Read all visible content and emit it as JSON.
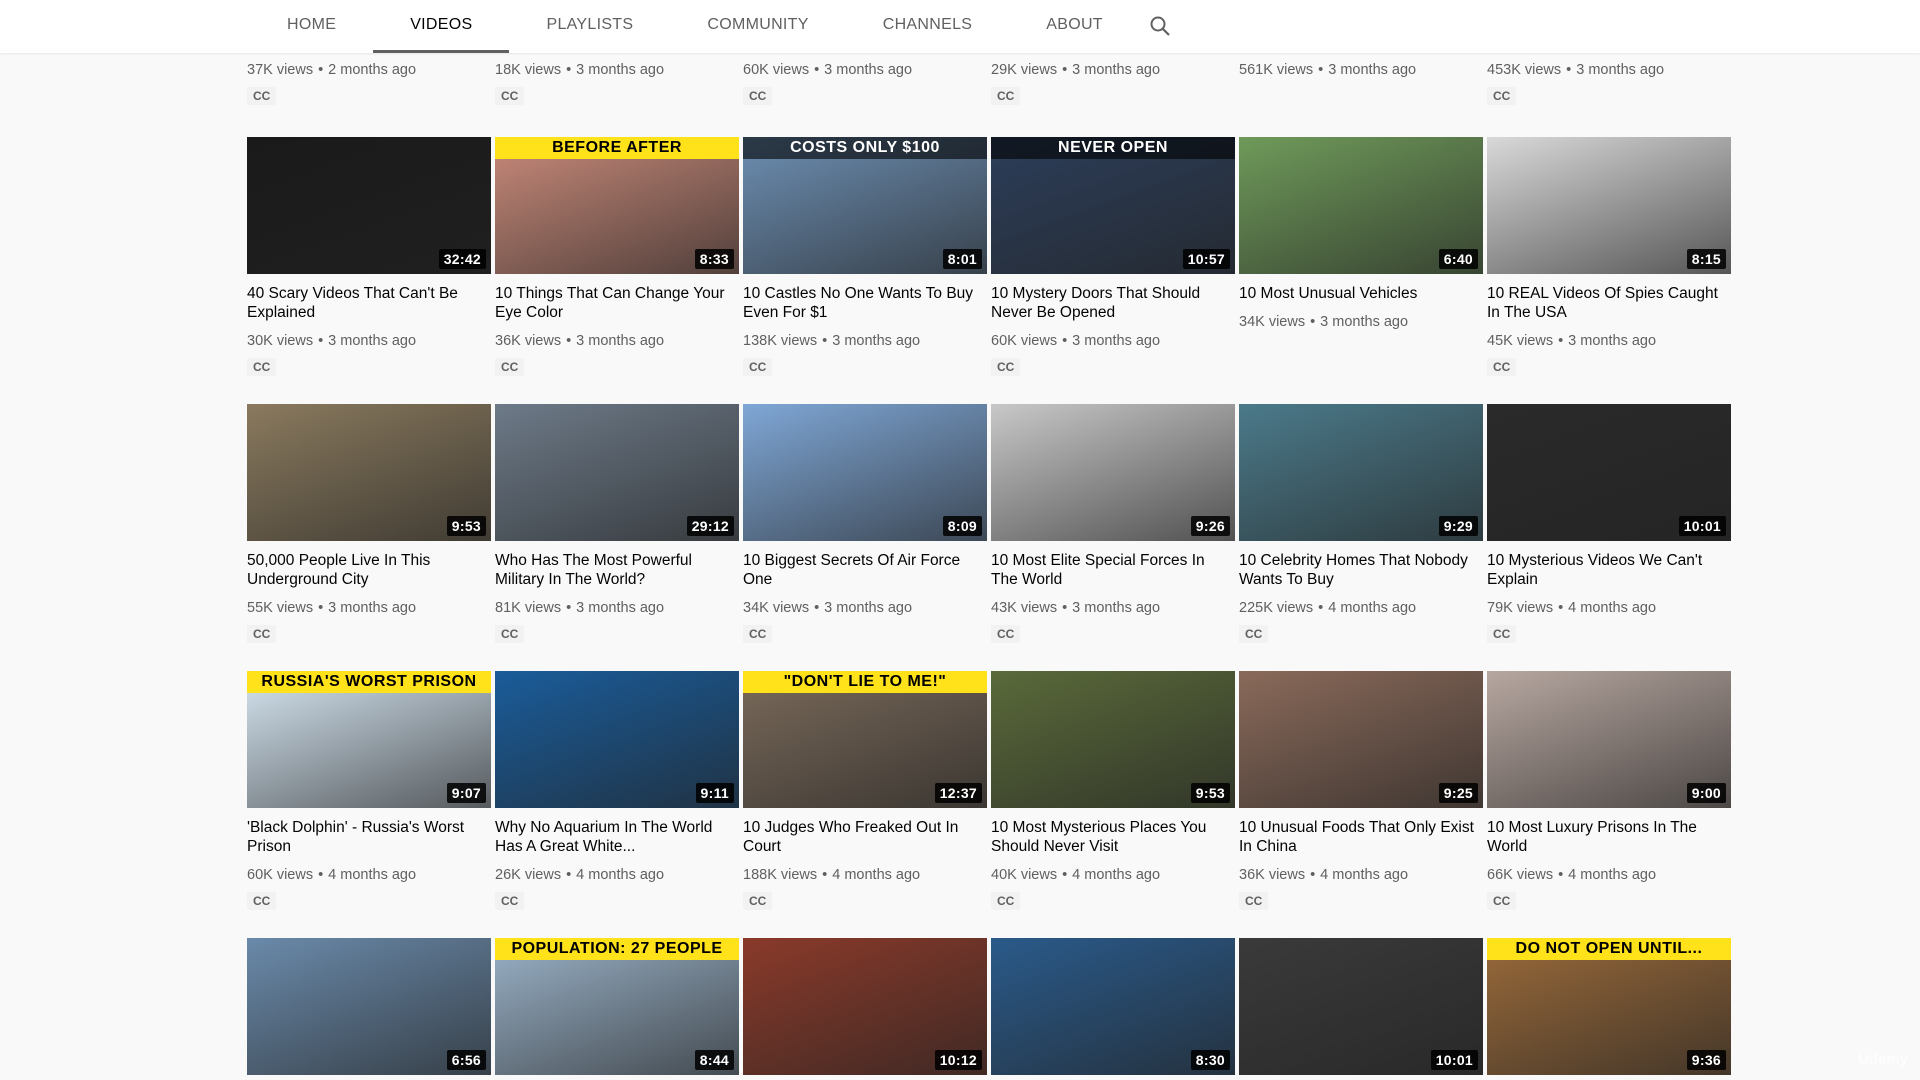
{
  "tabs": [
    {
      "label": "HOME",
      "active": false
    },
    {
      "label": "VIDEOS",
      "active": true
    },
    {
      "label": "PLAYLISTS",
      "active": false
    },
    {
      "label": "COMMUNITY",
      "active": false
    },
    {
      "label": "CHANNELS",
      "active": false
    },
    {
      "label": "ABOUT",
      "active": false
    }
  ],
  "search_icon": "search-icon",
  "top_row": [
    {
      "views": "37K views",
      "age": "2 months ago",
      "cc": "CC"
    },
    {
      "views": "18K views",
      "age": "3 months ago",
      "cc": "CC"
    },
    {
      "views": "60K views",
      "age": "3 months ago",
      "cc": "CC"
    },
    {
      "views": "29K views",
      "age": "3 months ago",
      "cc": "CC"
    },
    {
      "views": "561K views",
      "age": "3 months ago",
      "cc": ""
    },
    {
      "views": "453K views",
      "age": "3 months ago",
      "cc": "CC"
    }
  ],
  "rows": [
    [
      {
        "title": "40 Scary Videos That Can't Be Explained",
        "duration": "32:42",
        "views": "30K views",
        "age": "3 months ago",
        "cc": "CC",
        "caption": ""
      },
      {
        "title": "10 Things That Can Change Your Eye Color",
        "duration": "8:33",
        "views": "36K views",
        "age": "3 months ago",
        "cc": "CC",
        "caption": "BEFORE        AFTER"
      },
      {
        "title": "10 Castles No One Wants To Buy Even For $1",
        "duration": "8:01",
        "views": "138K views",
        "age": "3 months ago",
        "cc": "CC",
        "caption": "COSTS ONLY $100"
      },
      {
        "title": "10 Mystery Doors That Should Never Be Opened",
        "duration": "10:57",
        "views": "60K views",
        "age": "3 months ago",
        "cc": "CC",
        "caption": "NEVER OPEN"
      },
      {
        "title": "10 Most Unusual Vehicles",
        "duration": "6:40",
        "views": "34K views",
        "age": "3 months ago",
        "cc": "",
        "caption": ""
      },
      {
        "title": "10 REAL Videos Of Spies Caught In The USA",
        "duration": "8:15",
        "views": "45K views",
        "age": "3 months ago",
        "cc": "CC",
        "caption": ""
      }
    ],
    [
      {
        "title": "50,000 People Live In This Underground City",
        "duration": "9:53",
        "views": "55K views",
        "age": "3 months ago",
        "cc": "CC",
        "caption": ""
      },
      {
        "title": "Who Has The Most Powerful Military In The World?",
        "duration": "29:12",
        "views": "81K views",
        "age": "3 months ago",
        "cc": "CC",
        "caption": ""
      },
      {
        "title": "10 Biggest Secrets Of Air Force One",
        "duration": "8:09",
        "views": "34K views",
        "age": "3 months ago",
        "cc": "CC",
        "caption": ""
      },
      {
        "title": "10 Most Elite Special Forces In The World",
        "duration": "9:26",
        "views": "43K views",
        "age": "3 months ago",
        "cc": "CC",
        "caption": ""
      },
      {
        "title": "10 Celebrity Homes That Nobody Wants To Buy",
        "duration": "9:29",
        "views": "225K views",
        "age": "4 months ago",
        "cc": "CC",
        "caption": ""
      },
      {
        "title": "10 Mysterious Videos We Can't Explain",
        "duration": "10:01",
        "views": "79K views",
        "age": "4 months ago",
        "cc": "CC",
        "caption": ""
      }
    ],
    [
      {
        "title": "'Black Dolphin' - Russia's Worst Prison",
        "duration": "9:07",
        "views": "60K views",
        "age": "4 months ago",
        "cc": "CC",
        "caption": "RUSSIA'S WORST PRISON"
      },
      {
        "title": "Why No Aquarium In The World Has A Great White...",
        "duration": "9:11",
        "views": "26K views",
        "age": "4 months ago",
        "cc": "CC",
        "caption": ""
      },
      {
        "title": "10 Judges Who Freaked Out In Court",
        "duration": "12:37",
        "views": "188K views",
        "age": "4 months ago",
        "cc": "CC",
        "caption": "\"DON'T LIE TO ME!\""
      },
      {
        "title": "10 Most Mysterious Places You Should Never Visit",
        "duration": "9:53",
        "views": "40K views",
        "age": "4 months ago",
        "cc": "CC",
        "caption": ""
      },
      {
        "title": "10 Unusual Foods That Only Exist In China",
        "duration": "9:25",
        "views": "36K views",
        "age": "4 months ago",
        "cc": "CC",
        "caption": ""
      },
      {
        "title": "10 Most Luxury Prisons In The World",
        "duration": "9:00",
        "views": "66K views",
        "age": "4 months ago",
        "cc": "CC",
        "caption": ""
      }
    ],
    [
      {
        "duration": "6:56",
        "caption": ""
      },
      {
        "duration": "8:44",
        "caption": "POPULATION: 27 PEOPLE"
      },
      {
        "duration": "10:12",
        "caption": ""
      },
      {
        "duration": "8:30",
        "caption": ""
      },
      {
        "duration": "10:01",
        "caption": ""
      },
      {
        "duration": "9:36",
        "caption": "DO NOT OPEN UNTIL..."
      }
    ]
  ],
  "thumb_colors": [
    [
      "#1a1a1a",
      "#c98a7a",
      "#6d8fb3",
      "#2c3e5a",
      "#6f9a5a",
      "#d9d9d9"
    ],
    [
      "#8a7a5e",
      "#6d7a88",
      "#7fa7d6",
      "#c8c8c8",
      "#4b7a8a",
      "#2a2a2a"
    ],
    [
      "#d6e6f2",
      "#1a5c9a",
      "#7a6a5a",
      "#5a6a3a",
      "#8a6a5a",
      "#b7a7a0"
    ],
    [
      "#6a8aaa",
      "#9ab2c8",
      "#8a3a2a",
      "#2a5a8a",
      "#3a3a3a",
      "#9a6a3a"
    ]
  ],
  "watermark": "Udemy"
}
